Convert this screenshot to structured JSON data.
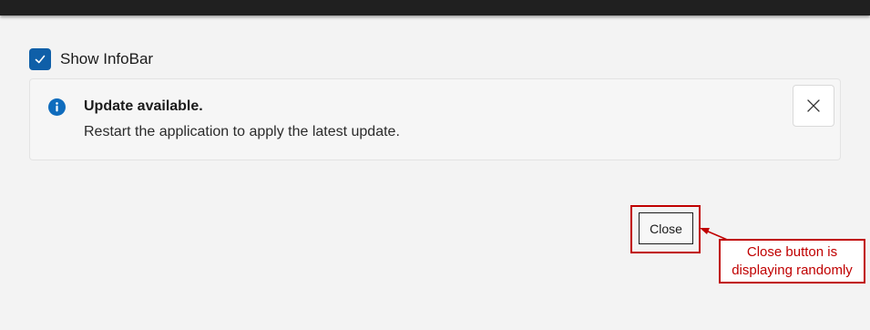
{
  "infobar_settings": {
    "checkbox_label": "Show InfoBar",
    "checkbox_checked": true
  },
  "infobar": {
    "title": "Update available.",
    "message": "Restart the application to apply the latest update.",
    "icon": "info-icon",
    "dismiss_icon": "close-icon"
  },
  "dialog": {
    "close_label": "Close"
  },
  "annotation": {
    "text": "Close button is displaying randomly",
    "color": "#c00000"
  },
  "colors": {
    "accent": "#0f5fa8",
    "info_icon": "#0f6cbd",
    "annotation": "#c00000"
  }
}
